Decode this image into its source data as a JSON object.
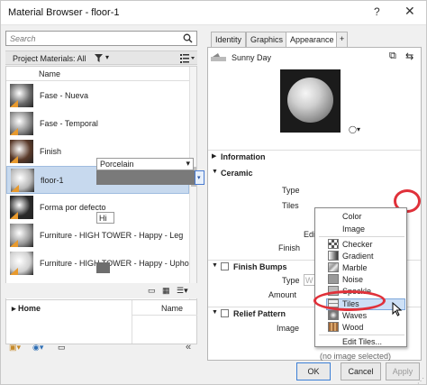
{
  "window": {
    "title": "Material Browser - floor-1",
    "help_icon": "help-icon",
    "close_icon": "close-icon"
  },
  "left": {
    "search": {
      "placeholder": "Search"
    },
    "project_materials_label": "Project Materials: All",
    "list_header": "Name",
    "materials": [
      {
        "name": "Fase - Nueva",
        "swatch": "#6a6a6a",
        "selected": false
      },
      {
        "name": "Fase - Temporal",
        "swatch": "#8a8a8a",
        "selected": false
      },
      {
        "name": "Finish",
        "swatch": "#5a3a2a",
        "selected": false
      },
      {
        "name": "floor-1",
        "swatch": "#b8b8b8",
        "selected": true
      },
      {
        "name": "Forma por defecto",
        "swatch": "#2a2a2a",
        "selected": false
      },
      {
        "name": "Furniture - HIGH TOWER - Happy - Leg",
        "swatch": "#9a9a9a",
        "selected": false
      },
      {
        "name": "Furniture - HIGH TOWER - Happy - Upholst",
        "swatch": "#d0d0d0",
        "selected": false
      }
    ],
    "library": {
      "tree_item": "Home",
      "name_header": "Name"
    }
  },
  "right": {
    "tabs": [
      {
        "label": "Identity",
        "active": false
      },
      {
        "label": "Graphics",
        "active": false
      },
      {
        "label": "Appearance",
        "active": true
      },
      {
        "label": "+",
        "active": false
      }
    ],
    "asset_name": "Sunny Day",
    "sections": {
      "information": "Information",
      "ceramic": "Ceramic",
      "finish_bumps": "Finish Bumps",
      "relief_pattern": "Relief Pattern"
    },
    "fields": {
      "type_label": "Type",
      "type_value": "Porcelain",
      "tiles_label": "Tiles",
      "edit_label": "Edit",
      "finish_label": "Finish",
      "finish_value": "Hi",
      "bumps_type_label": "Type",
      "bumps_type_value": "W",
      "amount_label": "Amount",
      "image_label": "Image",
      "image_note": "(no image selected)"
    },
    "tiles_menu": {
      "group1": [
        "Color",
        "Image"
      ],
      "group2": [
        "Checker",
        "Gradient",
        "Marble",
        "Noise",
        "Speckle",
        "Tiles",
        "Waves",
        "Wood"
      ],
      "highlighted": "Tiles",
      "edit_item": "Edit Tiles..."
    }
  },
  "footer": {
    "ok": "OK",
    "cancel": "Cancel",
    "apply": "Apply"
  },
  "colors": {
    "selection": "#c7d9ee",
    "annotation": "#e0313a",
    "accent": "#3c7fd6"
  }
}
